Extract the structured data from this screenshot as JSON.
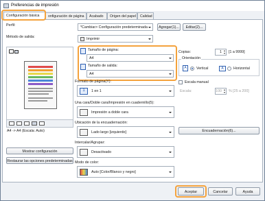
{
  "window": {
    "title": "Preferencias de impresión"
  },
  "tabs": [
    {
      "label": "Configuración básica"
    },
    {
      "label": "onfiguración de página"
    },
    {
      "label": "Acabado"
    },
    {
      "label": "Origen del papel"
    },
    {
      "label": "Calidad"
    }
  ],
  "profile": {
    "label": "Perfil:",
    "value": "*Cambiar> Configuración predeterminada",
    "add_label": "Agregar(1)...",
    "edit_label": "Editar(2)..."
  },
  "output_method": {
    "label": "Método de salida:",
    "value": "Imprimir"
  },
  "preview": {
    "caption": "A4 -> A4 (Escala: Auto)",
    "show_settings_label": "Mostrar configuración",
    "restore_defaults_label": "Restaurar las opciones predeterminadas"
  },
  "page_size": {
    "label": "Tamaño de página:",
    "value": "A4"
  },
  "output_size": {
    "label": "Tamaño de salida:",
    "value": "A4"
  },
  "copies": {
    "label": "Copias:",
    "value": "1",
    "range": "[1 a 9999]"
  },
  "orientation": {
    "label": "Orientación",
    "portrait_label": "Vertical",
    "landscape_label": "Horizontal",
    "selected": "Vertical"
  },
  "page_layout": {
    "label": "Formato de página(Y):",
    "value": "1 en 1"
  },
  "manual_scaling": {
    "label": "Escala manual",
    "scale_label": "Escala:",
    "value": "100",
    "range": "% [25 a 200]"
  },
  "duplex": {
    "label": "Una cara/Doble cara/Impresión en cuadernillo(5):",
    "value": "Impresión a doble cara"
  },
  "binding_location": {
    "label": "Ubicación de la encuadernación:",
    "value": "Lado largo [izquierdo]",
    "button_label": "Encuadernación(6)..."
  },
  "collate": {
    "label": "Intercalar/Agrupar:",
    "value": "Desactivado"
  },
  "color_mode": {
    "label": "Modo de color:",
    "value": "Auto [Color/Blanco y negro]"
  },
  "footer": {
    "ok_label": "Aceptar",
    "cancel_label": "Cancelar",
    "help_label": "Ayuda"
  },
  "colors": {
    "highlight": "#f4a23c",
    "accent": "#2a5db0"
  }
}
